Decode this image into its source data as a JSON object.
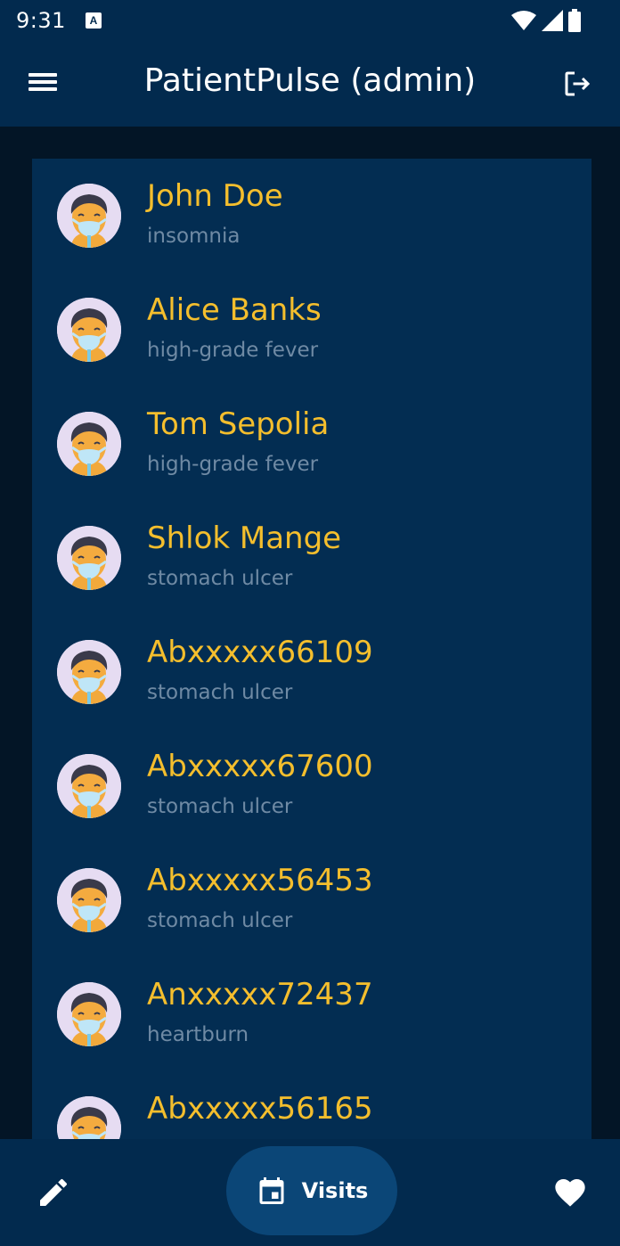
{
  "status_bar": {
    "time": "9:31",
    "notification_badge": "A"
  },
  "app_bar": {
    "title": "PatientPulse (admin)"
  },
  "patients": [
    {
      "name": "John Doe",
      "condition": "insomnia"
    },
    {
      "name": "Alice Banks",
      "condition": "high-grade fever"
    },
    {
      "name": "Tom Sepolia",
      "condition": "high-grade fever"
    },
    {
      "name": "Shlok Mange",
      "condition": "stomach ulcer"
    },
    {
      "name": "Abxxxxx66109",
      "condition": "stomach ulcer"
    },
    {
      "name": "Abxxxxx67600",
      "condition": "stomach ulcer"
    },
    {
      "name": "Abxxxxx56453",
      "condition": "stomach ulcer"
    },
    {
      "name": "Anxxxxx72437",
      "condition": "heartburn"
    },
    {
      "name": "Abxxxxx56165",
      "condition": ""
    }
  ],
  "bottom_bar": {
    "visits_label": "Visits"
  },
  "colors": {
    "app_bar": "#022a4e",
    "list_background": "#032d52",
    "page_background": "#031526",
    "name_text": "#f4be2d",
    "condition_text": "#6f8aa4",
    "visits_button": "#0b4677"
  },
  "icons": {
    "menu": "menu-icon",
    "logout": "logout-icon",
    "avatar": "patient-mask-avatar-icon",
    "edit": "pencil-icon",
    "visits": "calendar-icon",
    "favorite": "heart-icon",
    "wifi": "wifi-icon",
    "signal": "signal-icon",
    "battery": "battery-icon"
  }
}
